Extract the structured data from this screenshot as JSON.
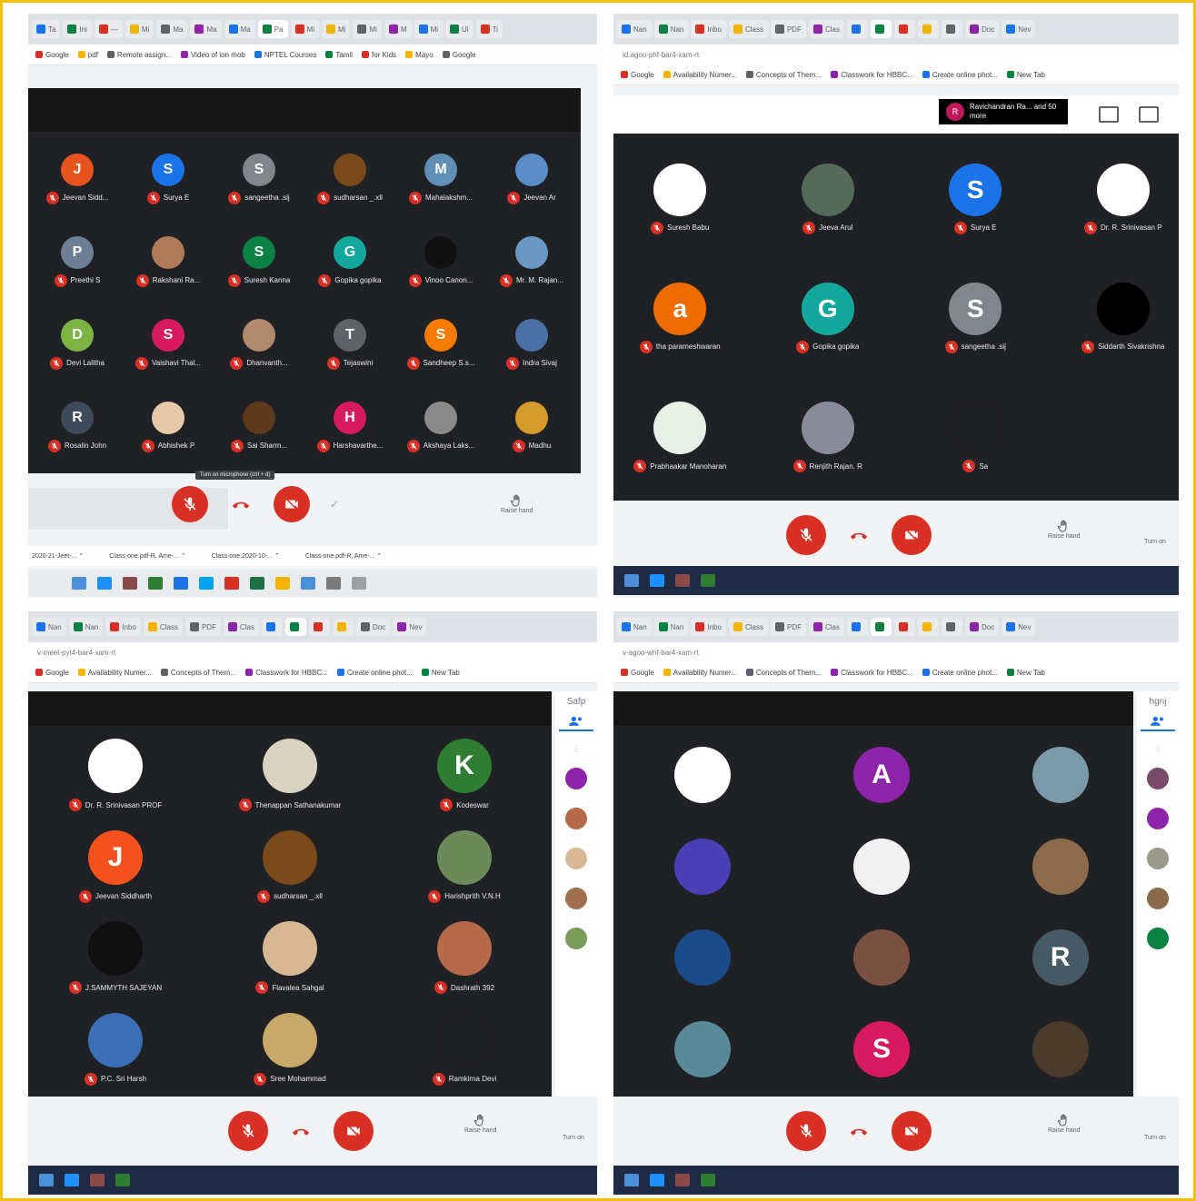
{
  "panels": [
    {
      "address": "",
      "tabs": [
        "Ta",
        "Ini",
        "—",
        "Mi",
        "Ma",
        "Ma",
        "Ma",
        "Pa",
        "Mi",
        "Mi",
        "Mi",
        "M",
        "Mi",
        "Ui",
        "Ti"
      ],
      "bookmarks": [
        "Google",
        "pdf",
        "Remote assign...",
        "Video of ion mob",
        "NPTEL Courses",
        "Tamil",
        "for Kids",
        "Mayo",
        "Google"
      ],
      "participants": [
        {
          "initial": "J",
          "color": "#e8541f",
          "name": "Jeevan Sidd..."
        },
        {
          "initial": "S",
          "color": "#1a73e8",
          "name": "Surya E"
        },
        {
          "initial": "S",
          "color": "#80868b",
          "name": "sangeetha .sij"
        },
        {
          "initial": "",
          "color": "#7a4a1a",
          "name": "sudharsan _.xll"
        },
        {
          "initial": "M",
          "color": "#5f8fb5",
          "name": "Mahalakshm..."
        },
        {
          "initial": "",
          "color": "#5a8cc8",
          "name": "Jeevan Ar"
        },
        {
          "initial": "P",
          "color": "#6d7f95",
          "name": "Preethi S"
        },
        {
          "initial": "",
          "color": "#b07a5a",
          "name": "Rakshani Ra..."
        },
        {
          "initial": "S",
          "color": "#0b8043",
          "name": "Suresh Kanna"
        },
        {
          "initial": "G",
          "color": "#12a89d",
          "name": "Gopika gopika"
        },
        {
          "initial": "",
          "color": "#111111",
          "name": "Vinoo Canon..."
        },
        {
          "initial": "",
          "color": "#6a98c2",
          "name": "Mr. M. Rajan..."
        },
        {
          "initial": "D",
          "color": "#7cb342",
          "name": "Devi Lalitha"
        },
        {
          "initial": "S",
          "color": "#d81b60",
          "name": "Vaishavi Thal..."
        },
        {
          "initial": "",
          "color": "#b08a6a",
          "name": "Dhanvanth..."
        },
        {
          "initial": "T",
          "color": "#5f6368",
          "name": "Tejaswini"
        },
        {
          "initial": "S",
          "color": "#f57c00",
          "name": "Sandheep S.s..."
        },
        {
          "initial": "",
          "color": "#4a6fa5",
          "name": "Indra Sivaj"
        },
        {
          "initial": "R",
          "color": "#3c4a5a",
          "name": "Rosalin John"
        },
        {
          "initial": "",
          "color": "#e6c9a8",
          "name": "Abhishek P"
        },
        {
          "initial": "",
          "color": "#5d3a1a",
          "name": "Sai Sharm..."
        },
        {
          "initial": "H",
          "color": "#d81b60",
          "name": "Harshavarthe..."
        },
        {
          "initial": "",
          "color": "#8a8a8a",
          "name": "Akshaya Laks..."
        },
        {
          "initial": "",
          "color": "#d49a2a",
          "name": "Madhu"
        }
      ],
      "tooltip": "Turn on microphone (ctrl + d)",
      "raise_hand": "Raise hand",
      "download_bar": [
        "2020-21-Jeet-...",
        "Class-one.pdf-R, Ame-...",
        "Class-one.2020-10-...",
        "Class-one.pdf-R, Ame-..."
      ],
      "taskbar": [
        "search",
        "task-view",
        "folder",
        "mail",
        "edge",
        "skype",
        "antivirus",
        "excel",
        "chrome",
        "meet",
        "photos",
        "files"
      ]
    },
    {
      "address": "id.agoo-phf-bar4-xam-rt",
      "tabs": [
        "Nan",
        "Nan",
        "Inbo",
        "Class",
        "PDF",
        "Clas",
        "",
        "",
        "",
        "",
        "",
        "Doc",
        "Nev"
      ],
      "bookmarks": [
        "Google",
        "Availability Numer...",
        "Concepts of Thern...",
        "Classwork for HBBC...",
        "Create online phot...",
        "New Tab"
      ],
      "presenter": "Ravichandran Ra... and 50 more",
      "presenter_initial": "R",
      "participants": [
        {
          "initial": "",
          "color": "#ffffff",
          "name": "Suresh Babu"
        },
        {
          "initial": "",
          "color": "#556b5a",
          "name": "Jeeva Arul"
        },
        {
          "initial": "S",
          "color": "#1a73e8",
          "name": "Surya E"
        },
        {
          "initial": "",
          "color": "#ffffff",
          "name": "Dr. R. Srinivasan P"
        },
        {
          "initial": "a",
          "color": "#ef6c00",
          "name": "tha parameshwaran"
        },
        {
          "initial": "G",
          "color": "#12a89d",
          "name": "Gopika gopika"
        },
        {
          "initial": "S",
          "color": "#80868b",
          "name": "sangeetha .sij"
        },
        {
          "initial": "",
          "color": "#000000",
          "name": "Siddarth Sivakrishna"
        },
        {
          "initial": "",
          "color": "#e8efe5",
          "name": "Prabhaakar Manoharan"
        },
        {
          "initial": "",
          "color": "#8a8a9a",
          "name": "Renjith Rajan. R"
        },
        {
          "initial": "",
          "color": "#202124",
          "name": "Sa"
        }
      ],
      "raise_hand": "Raise hand",
      "turn_on": "Turn on",
      "taskbar": [
        "mail",
        "files",
        "meet",
        "excel"
      ]
    },
    {
      "address": "v-meet-pyt4-bar4-xam-rt",
      "tabs": [
        "Nan",
        "Nan",
        "Inbo",
        "Class",
        "PDF",
        "Clas",
        "",
        "",
        "",
        "",
        "Doc",
        "Nev"
      ],
      "bookmarks": [
        "Google",
        "Availability Numer...",
        "Concepts of Thern...",
        "Classwork for HBBC...",
        "Create online phot...",
        "New Tab"
      ],
      "side_title": "Safp",
      "participants": [
        {
          "initial": "",
          "color": "#ffffff",
          "name": "Dr. R. Srinivasan PROF"
        },
        {
          "initial": "",
          "color": "#d9d2c0",
          "name": "Thenappan Sathanakumar"
        },
        {
          "initial": "K",
          "color": "#2e7d32",
          "name": "Kodeswar"
        },
        {
          "initial": "J",
          "color": "#f4511e",
          "name": "Jeevan Siddharth"
        },
        {
          "initial": "",
          "color": "#7a4a1a",
          "name": "sudharsan _.xll"
        },
        {
          "initial": "",
          "color": "#6a8a5a",
          "name": "Harishprith V.N.H"
        },
        {
          "initial": "",
          "color": "#111111",
          "name": "J.SAMMYTH SAJEYAN"
        },
        {
          "initial": "",
          "color": "#d8b894",
          "name": "Flavalea Sahgal"
        },
        {
          "initial": "",
          "color": "#b76a4a",
          "name": "Dashrath 392"
        },
        {
          "initial": "",
          "color": "#3b6fb5",
          "name": "P.C. Sri Harsh"
        },
        {
          "initial": "",
          "color": "#c9a96a",
          "name": "Sree Mohammad"
        },
        {
          "initial": "",
          "color": "#202124",
          "name": "Ramkirna Devi"
        }
      ],
      "raise_hand": "Raise hand",
      "turn_on": "Turn on",
      "taskbar": [
        "mail",
        "files",
        "meet",
        "excel"
      ]
    },
    {
      "address": "v-agoo-whf-bar4-xam-rt",
      "tabs": [
        "Nan",
        "Nan",
        "Inbo",
        "Class",
        "PDF",
        "Clas",
        "",
        "",
        "",
        "",
        "",
        "Doc",
        "Nev"
      ],
      "bookmarks": [
        "Google",
        "Availability Numer...",
        "Concepts of Thern...",
        "Classwork for HBBC...",
        "Create online phot...",
        "New Tab"
      ],
      "side_title": "hgnj",
      "participants": [
        {
          "initial": "",
          "color": "#ffffff",
          "name": ""
        },
        {
          "initial": "A",
          "color": "#8e24aa",
          "name": ""
        },
        {
          "initial": "",
          "color": "#7a9aaa",
          "name": ""
        },
        {
          "initial": "",
          "color": "#4b3fb5",
          "name": ""
        },
        {
          "initial": "",
          "color": "#f1f1f1",
          "name": ""
        },
        {
          "initial": "",
          "color": "#8c6a4a",
          "name": ""
        },
        {
          "initial": "",
          "color": "#1a4a8a",
          "name": ""
        },
        {
          "initial": "",
          "color": "#7a5040",
          "name": ""
        },
        {
          "initial": "R",
          "color": "#455a64",
          "name": ""
        },
        {
          "initial": "",
          "color": "#5a8a9a",
          "name": ""
        },
        {
          "initial": "S",
          "color": "#d81b60",
          "name": ""
        },
        {
          "initial": "",
          "color": "#4a3a2a",
          "name": ""
        }
      ],
      "raise_hand": "Raise hand",
      "turn_on": "Turn on",
      "taskbar": [
        "mail",
        "files",
        "meet",
        "excel"
      ]
    }
  ],
  "colors": {
    "accent": "#d93025",
    "meet_bg": "#202124",
    "frame_border": "#f2c200",
    "taskbar": "#1f2a44"
  },
  "icons": {
    "mic_off": "mic-off-icon",
    "cam_off": "camera-off-icon",
    "end_call": "end-call-icon",
    "raise_hand": "hand-icon",
    "people": "people-icon"
  }
}
